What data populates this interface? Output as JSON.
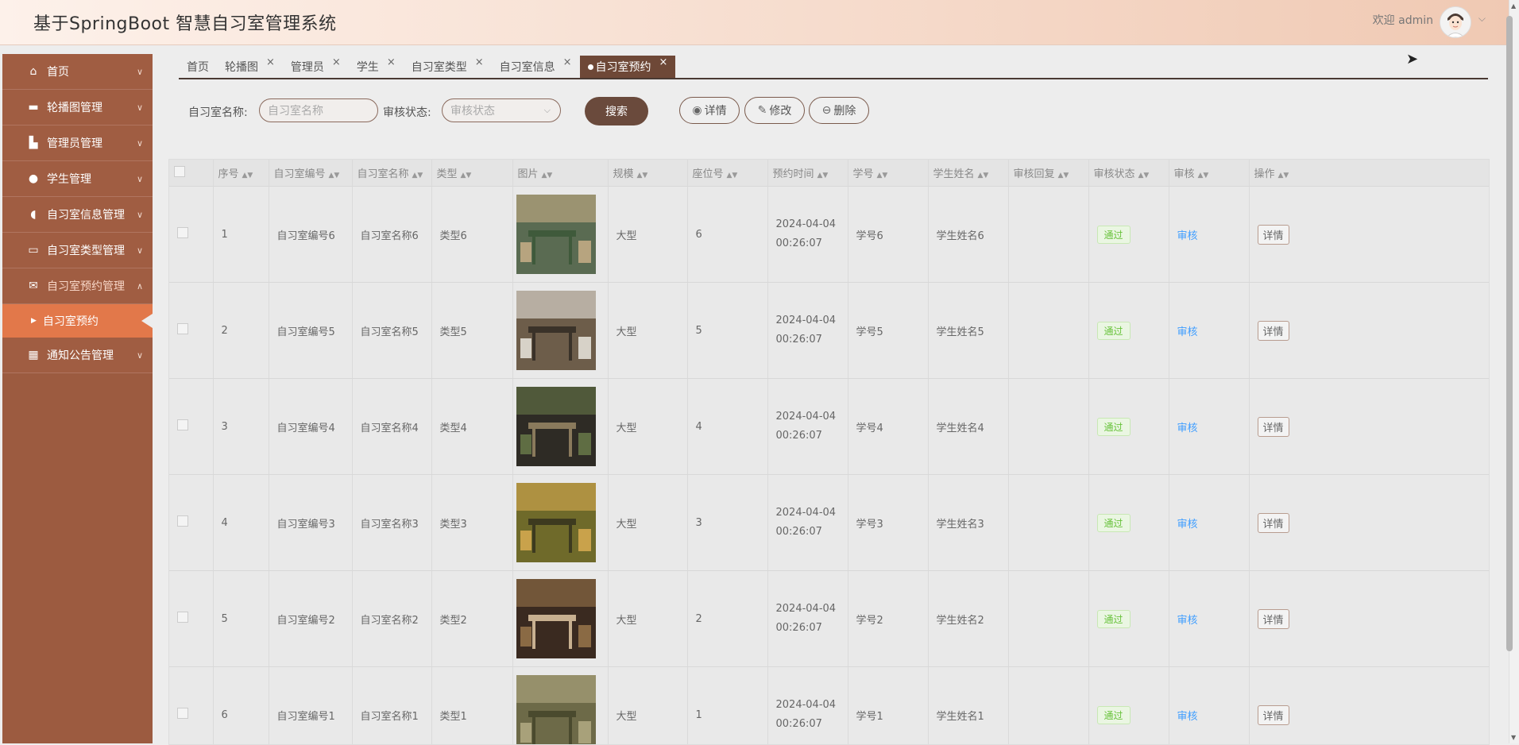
{
  "header": {
    "title": "基于SpringBoot 智慧自习室管理系统",
    "welcome": "欢迎 admin"
  },
  "sidebar": {
    "items": [
      {
        "label": "首页",
        "icon": "home-icon"
      },
      {
        "label": "轮播图管理",
        "icon": "carousel-icon"
      },
      {
        "label": "管理员管理",
        "icon": "admin-icon"
      },
      {
        "label": "学生管理",
        "icon": "student-icon"
      },
      {
        "label": "自习室信息管理",
        "icon": "room-info-icon"
      },
      {
        "label": "自习室类型管理",
        "icon": "room-type-icon"
      },
      {
        "label": "自习室预约管理",
        "icon": "reservation-icon"
      },
      {
        "label": "通知公告管理",
        "icon": "notice-icon"
      }
    ],
    "sub_item": "自习室预约"
  },
  "tabs": [
    {
      "label": "首页"
    },
    {
      "label": "轮播图"
    },
    {
      "label": "管理员"
    },
    {
      "label": "学生"
    },
    {
      "label": "自习室类型"
    },
    {
      "label": "自习室信息"
    },
    {
      "label": "自习室预约"
    }
  ],
  "search": {
    "room_name_label": "自习室名称:",
    "room_name_placeholder": "自习室名称",
    "status_label": "审核状态:",
    "status_placeholder": "审核状态",
    "search_button": "搜索",
    "detail_button": "详情",
    "edit_button": "修改",
    "delete_button": "删除"
  },
  "table": {
    "columns": [
      "序号",
      "自习室编号",
      "自习室名称",
      "类型",
      "图片",
      "规模",
      "座位号",
      "预约时间",
      "学号",
      "学生姓名",
      "审核回复",
      "审核状态",
      "审核",
      "操作"
    ],
    "rows": [
      {
        "no": "1",
        "code": "自习室编号6",
        "name": "自习室名称6",
        "type": "类型6",
        "scale": "大型",
        "seat": "6",
        "time": "2024-04-04 00:26:07",
        "sid": "学号6",
        "sname": "学生姓名6",
        "reply": "",
        "status": "通过",
        "review": "审核",
        "op": "详情"
      },
      {
        "no": "2",
        "code": "自习室编号5",
        "name": "自习室名称5",
        "type": "类型5",
        "scale": "大型",
        "seat": "5",
        "time": "2024-04-04 00:26:07",
        "sid": "学号5",
        "sname": "学生姓名5",
        "reply": "",
        "status": "通过",
        "review": "审核",
        "op": "详情"
      },
      {
        "no": "3",
        "code": "自习室编号4",
        "name": "自习室名称4",
        "type": "类型4",
        "scale": "大型",
        "seat": "4",
        "time": "2024-04-04 00:26:07",
        "sid": "学号4",
        "sname": "学生姓名4",
        "reply": "",
        "status": "通过",
        "review": "审核",
        "op": "详情"
      },
      {
        "no": "4",
        "code": "自习室编号3",
        "name": "自习室名称3",
        "type": "类型3",
        "scale": "大型",
        "seat": "3",
        "time": "2024-04-04 00:26:07",
        "sid": "学号3",
        "sname": "学生姓名3",
        "reply": "",
        "status": "通过",
        "review": "审核",
        "op": "详情"
      },
      {
        "no": "5",
        "code": "自习室编号2",
        "name": "自习室名称2",
        "type": "类型2",
        "scale": "大型",
        "seat": "2",
        "time": "2024-04-04 00:26:07",
        "sid": "学号2",
        "sname": "学生姓名2",
        "reply": "",
        "status": "通过",
        "review": "审核",
        "op": "详情"
      },
      {
        "no": "6",
        "code": "自习室编号1",
        "name": "自习室名称1",
        "type": "类型1",
        "scale": "大型",
        "seat": "1",
        "time": "2024-04-04 00:26:07",
        "sid": "学号1",
        "sname": "学生姓名1",
        "reply": "",
        "status": "通过",
        "review": "审核",
        "op": "详情"
      }
    ]
  },
  "colors": {
    "sidebar_bg": "#a05d42",
    "active_sub": "#e2784a",
    "active_tab": "#6e4837",
    "search_btn": "#6a4a3c",
    "status_green": "#67c23a",
    "link_blue": "#409eff"
  }
}
